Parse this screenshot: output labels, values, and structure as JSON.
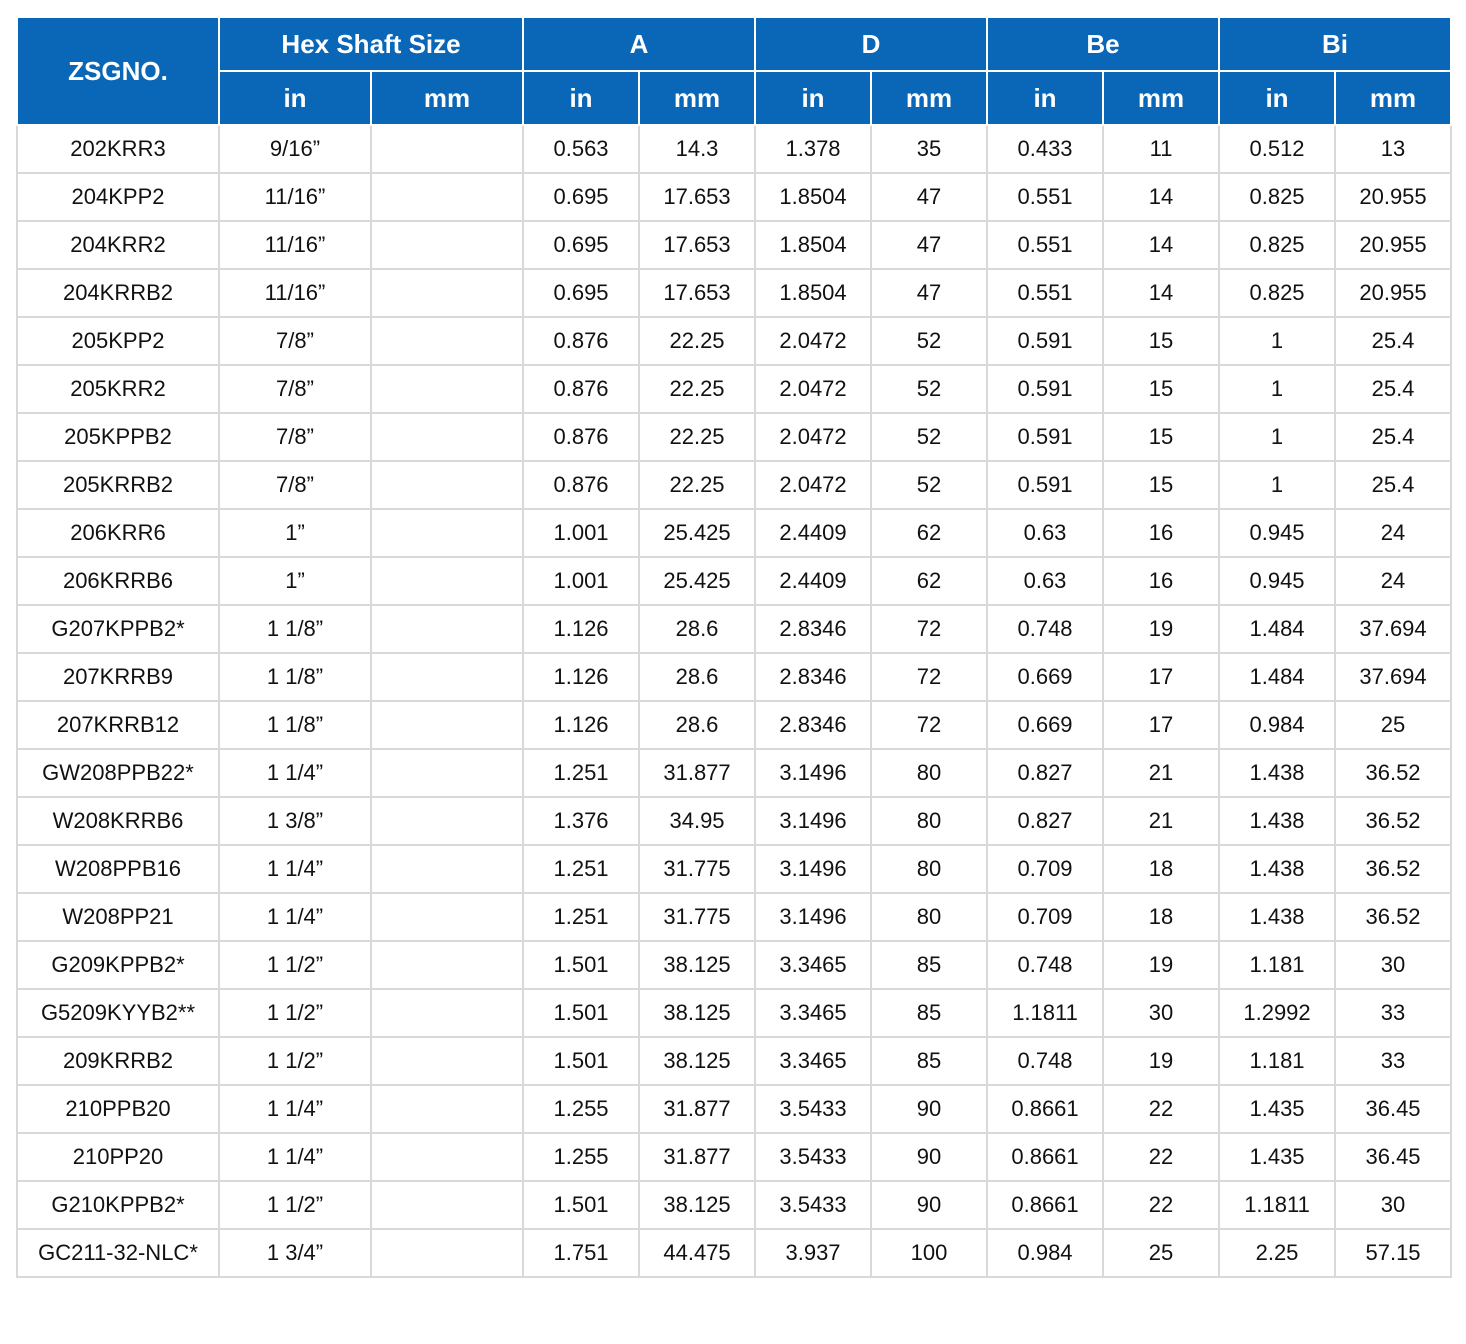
{
  "header": {
    "model": "ZSGNO.",
    "groups": [
      "Hex Shaft Size",
      "A",
      "D",
      "Be",
      "Bi"
    ],
    "units": [
      "in",
      "mm",
      "in",
      "mm",
      "in",
      "mm",
      "in",
      "mm",
      "in",
      "mm"
    ]
  },
  "rows": [
    [
      "202KRR3",
      "9/16”",
      "",
      "0.563",
      "14.3",
      "1.378",
      "35",
      "0.433",
      "11",
      "0.512",
      "13"
    ],
    [
      "204KPP2",
      "11/16”",
      "",
      "0.695",
      "17.653",
      "1.8504",
      "47",
      "0.551",
      "14",
      "0.825",
      "20.955"
    ],
    [
      "204KRR2",
      "11/16”",
      "",
      "0.695",
      "17.653",
      "1.8504",
      "47",
      "0.551",
      "14",
      "0.825",
      "20.955"
    ],
    [
      "204KRRB2",
      "11/16”",
      "",
      "0.695",
      "17.653",
      "1.8504",
      "47",
      "0.551",
      "14",
      "0.825",
      "20.955"
    ],
    [
      "205KPP2",
      "7/8”",
      "",
      "0.876",
      "22.25",
      "2.0472",
      "52",
      "0.591",
      "15",
      "1",
      "25.4"
    ],
    [
      "205KRR2",
      "7/8”",
      "",
      "0.876",
      "22.25",
      "2.0472",
      "52",
      "0.591",
      "15",
      "1",
      "25.4"
    ],
    [
      "205KPPB2",
      "7/8”",
      "",
      "0.876",
      "22.25",
      "2.0472",
      "52",
      "0.591",
      "15",
      "1",
      "25.4"
    ],
    [
      "205KRRB2",
      "7/8”",
      "",
      "0.876",
      "22.25",
      "2.0472",
      "52",
      "0.591",
      "15",
      "1",
      "25.4"
    ],
    [
      "206KRR6",
      "1”",
      "",
      "1.001",
      "25.425",
      "2.4409",
      "62",
      "0.63",
      "16",
      "0.945",
      "24"
    ],
    [
      "206KRRB6",
      "1”",
      "",
      "1.001",
      "25.425",
      "2.4409",
      "62",
      "0.63",
      "16",
      "0.945",
      "24"
    ],
    [
      "G207KPPB2*",
      "1 1/8”",
      "",
      "1.126",
      "28.6",
      "2.8346",
      "72",
      "0.748",
      "19",
      "1.484",
      "37.694"
    ],
    [
      "207KRRB9",
      "1 1/8”",
      "",
      "1.126",
      "28.6",
      "2.8346",
      "72",
      "0.669",
      "17",
      "1.484",
      "37.694"
    ],
    [
      "207KRRB12",
      "1 1/8”",
      "",
      "1.126",
      "28.6",
      "2.8346",
      "72",
      "0.669",
      "17",
      "0.984",
      "25"
    ],
    [
      "GW208PPB22*",
      "1 1/4”",
      "",
      "1.251",
      "31.877",
      "3.1496",
      "80",
      "0.827",
      "21",
      "1.438",
      "36.52"
    ],
    [
      "W208KRRB6",
      "1 3/8”",
      "",
      "1.376",
      "34.95",
      "3.1496",
      "80",
      "0.827",
      "21",
      "1.438",
      "36.52"
    ],
    [
      "W208PPB16",
      "1 1/4”",
      "",
      "1.251",
      "31.775",
      "3.1496",
      "80",
      "0.709",
      "18",
      "1.438",
      "36.52"
    ],
    [
      "W208PP21",
      "1 1/4”",
      "",
      "1.251",
      "31.775",
      "3.1496",
      "80",
      "0.709",
      "18",
      "1.438",
      "36.52"
    ],
    [
      "G209KPPB2*",
      "1 1/2”",
      "",
      "1.501",
      "38.125",
      "3.3465",
      "85",
      "0.748",
      "19",
      "1.181",
      "30"
    ],
    [
      "G5209KYYB2**",
      "1 1/2”",
      "",
      "1.501",
      "38.125",
      "3.3465",
      "85",
      "1.1811",
      "30",
      "1.2992",
      "33"
    ],
    [
      "209KRRB2",
      "1 1/2”",
      "",
      "1.501",
      "38.125",
      "3.3465",
      "85",
      "0.748",
      "19",
      "1.181",
      "33"
    ],
    [
      "210PPB20",
      "1 1/4”",
      "",
      "1.255",
      "31.877",
      "3.5433",
      "90",
      "0.8661",
      "22",
      "1.435",
      "36.45"
    ],
    [
      "210PP20",
      "1 1/4”",
      "",
      "1.255",
      "31.877",
      "3.5433",
      "90",
      "0.8661",
      "22",
      "1.435",
      "36.45"
    ],
    [
      "G210KPPB2*",
      "1 1/2”",
      "",
      "1.501",
      "38.125",
      "3.5433",
      "90",
      "0.8661",
      "22",
      "1.1811",
      "30"
    ],
    [
      "GC211-32-NLC*",
      "1 3/4”",
      "",
      "1.751",
      "44.475",
      "3.937",
      "100",
      "0.984",
      "25",
      "2.25",
      "57.15"
    ]
  ]
}
